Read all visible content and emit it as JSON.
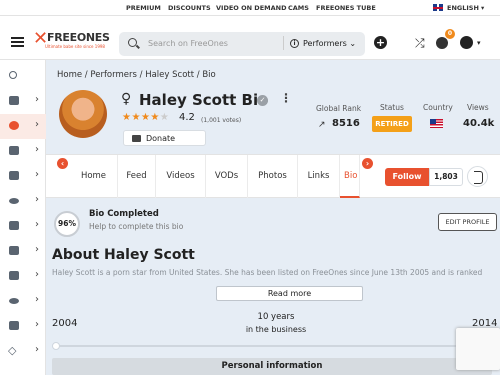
{
  "topbar": {
    "links": [
      "PREMIUM",
      "DISCOUNTS",
      "VIDEO ON DEMAND",
      "CAMS",
      "FREEONES TUBE"
    ],
    "language": "ENGLISH"
  },
  "header": {
    "logo_text": "FREEONES",
    "logo_tagline": "Ultimate babe site since 1998",
    "search_placeholder": "Search on FreeOnes",
    "search_category": "Performers",
    "coin_count": "0"
  },
  "sidebar": {
    "items": [
      {
        "icon": "search-icon"
      },
      {
        "icon": "news-icon"
      },
      {
        "icon": "performers-icon",
        "active": true
      },
      {
        "icon": "photos-icon"
      },
      {
        "icon": "videos-icon"
      },
      {
        "icon": "links-icon"
      },
      {
        "icon": "feed-icon"
      },
      {
        "icon": "vod-icon"
      },
      {
        "icon": "chat-icon"
      },
      {
        "icon": "games-icon"
      },
      {
        "icon": "forum-icon"
      },
      {
        "icon": "diamond-icon"
      }
    ]
  },
  "breadcrumb": [
    "Home",
    "Performers",
    "Haley Scott",
    "Bio"
  ],
  "profile": {
    "gender_symbol": "♀",
    "name": "Haley Scott Bio",
    "rating": "4.2",
    "rating_value": 4.2,
    "votes": "(1,001 votes)",
    "donate_label": "Donate"
  },
  "stats": {
    "global_rank_label": "Global Rank",
    "global_rank": "8516",
    "status_label": "Status",
    "status": "RETIRED",
    "country_label": "Country",
    "views_label": "Views",
    "views": "40.4k"
  },
  "tabs": [
    "Home",
    "Feed",
    "Videos",
    "VODs",
    "Photos",
    "Links",
    "Bio"
  ],
  "follow": {
    "label": "Follow",
    "count": "1,803"
  },
  "bio_completion": {
    "percent": "96%",
    "title": "Bio Completed",
    "subtitle": "Help to complete this bio",
    "edit_label": "EDIT PROFILE"
  },
  "about": {
    "title": "About Haley Scott",
    "text": "Haley Scott is a porn star from United States. She has been listed on FreeOnes since June 13th 2005 and is ranked",
    "read_more": "Read more"
  },
  "career": {
    "start": "2004",
    "end": "2014",
    "years": "10 years",
    "years_sub": "in the business"
  },
  "personal_info_label": "Personal information",
  "colors": {
    "accent": "#e8512f",
    "status": "#f4a018",
    "background": "#e6edf5"
  }
}
